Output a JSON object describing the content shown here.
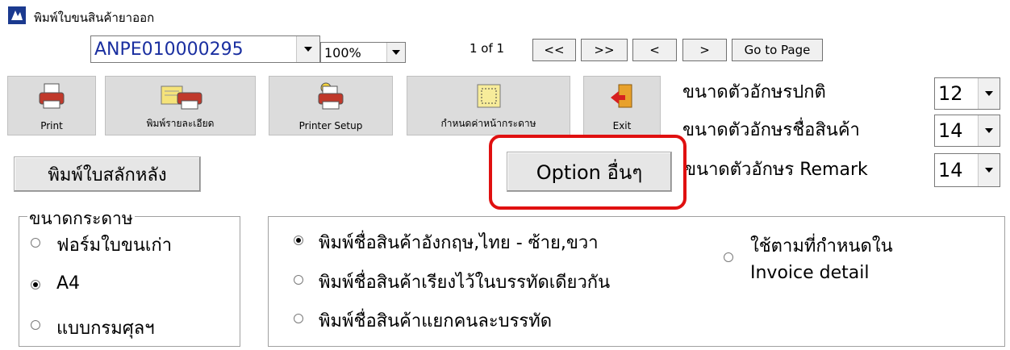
{
  "window": {
    "title": "พิมพ์ใบขนสินค้ายาออก"
  },
  "toolbar": {
    "document_number": "ANPE010000295",
    "zoom": "100%",
    "page_info": "1 of 1",
    "nav": {
      "first": "<<",
      "last": ">>",
      "prev": "<",
      "next": ">",
      "goto": "Go to Page"
    },
    "tools": {
      "print": "Print",
      "print_detail": "พิมพ์รายละเอียด",
      "printer_setup": "Printer Setup",
      "page_setup": "กำหนดค่าหน้ากระดาษ",
      "exit": "Exit"
    }
  },
  "font_sizes": {
    "normal": {
      "label": "ขนาดตัวอักษรปกติ",
      "value": "12"
    },
    "product": {
      "label": "ขนาดตัวอักษรชื่อสินค้า",
      "value": "14"
    },
    "remark": {
      "label": "ขนาดตัวอักษร Remark",
      "value": "14"
    }
  },
  "buttons": {
    "print_back": "พิมพ์ใบสลักหลัง",
    "other_options": "Option อื่นๆ"
  },
  "paper_size": {
    "legend": "ขนาดกระดาษ",
    "options": [
      "ฟอร์มใบขนเก่า",
      "A4",
      "แบบกรมศุลฯ"
    ],
    "selected": "A4"
  },
  "name_print": {
    "options": [
      "พิมพ์ชื่อสินค้าอังกฤษ,ไทย - ซ้าย,ขวา",
      "พิมพ์ชื่อสินค้าเรียงไว้ในบรรทัดเดียวกัน",
      "พิมพ์ชื่อสินค้าแยกคนละบรรทัด"
    ],
    "selected": "พิมพ์ชื่อสินค้าอังกฤษ,ไทย - ซ้าย,ขวา",
    "invoice_option_line1": "ใช้ตามที่กำหนดใน",
    "invoice_option_line2": "Invoice detail"
  },
  "colors": {
    "highlight": "#e01010",
    "doc_number_text": "#1a2fa0"
  }
}
